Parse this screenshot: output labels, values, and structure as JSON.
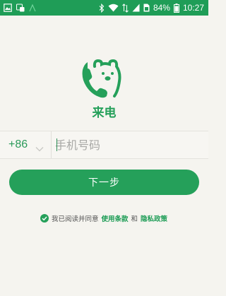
{
  "status_bar": {
    "battery": "84%",
    "time": "10:27",
    "background_color": "#1f9d57"
  },
  "app": {
    "name": "来电",
    "brand_color": "#25a05a"
  },
  "phone": {
    "country_code": "+86",
    "placeholder": "手机号码"
  },
  "next_button": {
    "label": "下一步"
  },
  "agreement": {
    "prefix": "我已阅读并同意",
    "terms_link": "使用条款",
    "and": "和",
    "privacy_link": "隐私政策",
    "checked": true
  }
}
